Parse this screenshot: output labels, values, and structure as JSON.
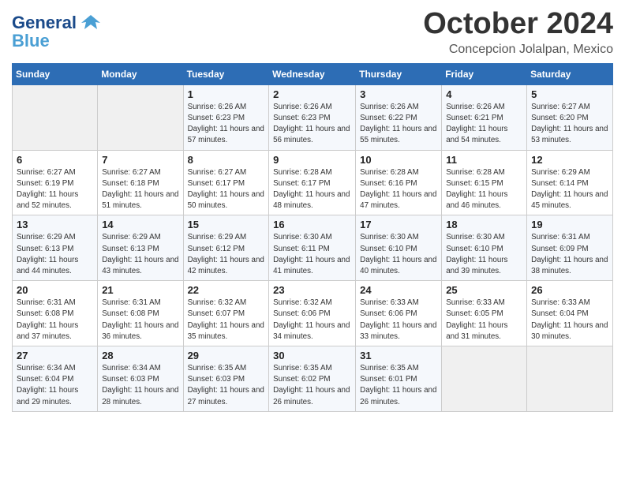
{
  "header": {
    "logo": {
      "line1": "General",
      "line2": "Blue"
    },
    "month": "October 2024",
    "location": "Concepcion Jolalpan, Mexico"
  },
  "weekdays": [
    "Sunday",
    "Monday",
    "Tuesday",
    "Wednesday",
    "Thursday",
    "Friday",
    "Saturday"
  ],
  "weeks": [
    [
      null,
      null,
      {
        "day": "1",
        "sunrise": "6:26 AM",
        "sunset": "6:23 PM",
        "daylight": "11 hours and 57 minutes."
      },
      {
        "day": "2",
        "sunrise": "6:26 AM",
        "sunset": "6:23 PM",
        "daylight": "11 hours and 56 minutes."
      },
      {
        "day": "3",
        "sunrise": "6:26 AM",
        "sunset": "6:22 PM",
        "daylight": "11 hours and 55 minutes."
      },
      {
        "day": "4",
        "sunrise": "6:26 AM",
        "sunset": "6:21 PM",
        "daylight": "11 hours and 54 minutes."
      },
      {
        "day": "5",
        "sunrise": "6:27 AM",
        "sunset": "6:20 PM",
        "daylight": "11 hours and 53 minutes."
      }
    ],
    [
      {
        "day": "6",
        "sunrise": "6:27 AM",
        "sunset": "6:19 PM",
        "daylight": "11 hours and 52 minutes."
      },
      {
        "day": "7",
        "sunrise": "6:27 AM",
        "sunset": "6:18 PM",
        "daylight": "11 hours and 51 minutes."
      },
      {
        "day": "8",
        "sunrise": "6:27 AM",
        "sunset": "6:17 PM",
        "daylight": "11 hours and 50 minutes."
      },
      {
        "day": "9",
        "sunrise": "6:28 AM",
        "sunset": "6:17 PM",
        "daylight": "11 hours and 48 minutes."
      },
      {
        "day": "10",
        "sunrise": "6:28 AM",
        "sunset": "6:16 PM",
        "daylight": "11 hours and 47 minutes."
      },
      {
        "day": "11",
        "sunrise": "6:28 AM",
        "sunset": "6:15 PM",
        "daylight": "11 hours and 46 minutes."
      },
      {
        "day": "12",
        "sunrise": "6:29 AM",
        "sunset": "6:14 PM",
        "daylight": "11 hours and 45 minutes."
      }
    ],
    [
      {
        "day": "13",
        "sunrise": "6:29 AM",
        "sunset": "6:13 PM",
        "daylight": "11 hours and 44 minutes."
      },
      {
        "day": "14",
        "sunrise": "6:29 AM",
        "sunset": "6:13 PM",
        "daylight": "11 hours and 43 minutes."
      },
      {
        "day": "15",
        "sunrise": "6:29 AM",
        "sunset": "6:12 PM",
        "daylight": "11 hours and 42 minutes."
      },
      {
        "day": "16",
        "sunrise": "6:30 AM",
        "sunset": "6:11 PM",
        "daylight": "11 hours and 41 minutes."
      },
      {
        "day": "17",
        "sunrise": "6:30 AM",
        "sunset": "6:10 PM",
        "daylight": "11 hours and 40 minutes."
      },
      {
        "day": "18",
        "sunrise": "6:30 AM",
        "sunset": "6:10 PM",
        "daylight": "11 hours and 39 minutes."
      },
      {
        "day": "19",
        "sunrise": "6:31 AM",
        "sunset": "6:09 PM",
        "daylight": "11 hours and 38 minutes."
      }
    ],
    [
      {
        "day": "20",
        "sunrise": "6:31 AM",
        "sunset": "6:08 PM",
        "daylight": "11 hours and 37 minutes."
      },
      {
        "day": "21",
        "sunrise": "6:31 AM",
        "sunset": "6:08 PM",
        "daylight": "11 hours and 36 minutes."
      },
      {
        "day": "22",
        "sunrise": "6:32 AM",
        "sunset": "6:07 PM",
        "daylight": "11 hours and 35 minutes."
      },
      {
        "day": "23",
        "sunrise": "6:32 AM",
        "sunset": "6:06 PM",
        "daylight": "11 hours and 34 minutes."
      },
      {
        "day": "24",
        "sunrise": "6:33 AM",
        "sunset": "6:06 PM",
        "daylight": "11 hours and 33 minutes."
      },
      {
        "day": "25",
        "sunrise": "6:33 AM",
        "sunset": "6:05 PM",
        "daylight": "11 hours and 31 minutes."
      },
      {
        "day": "26",
        "sunrise": "6:33 AM",
        "sunset": "6:04 PM",
        "daylight": "11 hours and 30 minutes."
      }
    ],
    [
      {
        "day": "27",
        "sunrise": "6:34 AM",
        "sunset": "6:04 PM",
        "daylight": "11 hours and 29 minutes."
      },
      {
        "day": "28",
        "sunrise": "6:34 AM",
        "sunset": "6:03 PM",
        "daylight": "11 hours and 28 minutes."
      },
      {
        "day": "29",
        "sunrise": "6:35 AM",
        "sunset": "6:03 PM",
        "daylight": "11 hours and 27 minutes."
      },
      {
        "day": "30",
        "sunrise": "6:35 AM",
        "sunset": "6:02 PM",
        "daylight": "11 hours and 26 minutes."
      },
      {
        "day": "31",
        "sunrise": "6:35 AM",
        "sunset": "6:01 PM",
        "daylight": "11 hours and 26 minutes."
      },
      null,
      null
    ]
  ]
}
